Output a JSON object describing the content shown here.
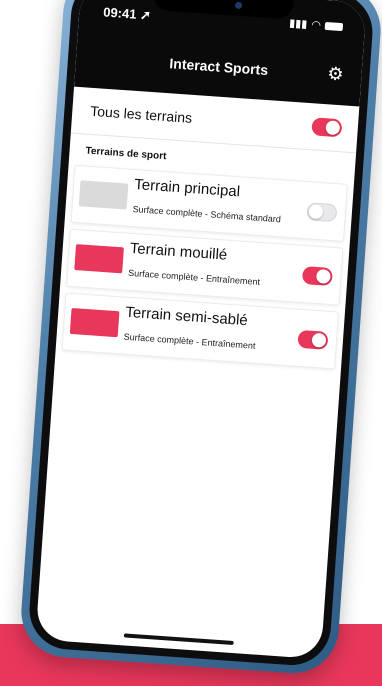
{
  "status_bar": {
    "time": "09:41"
  },
  "header": {
    "title": "Interact Sports"
  },
  "all_fields": {
    "label": "Tous les terrains",
    "enabled": true
  },
  "section": {
    "title": "Terrains de sport"
  },
  "fields": [
    {
      "name": "Terrain principal",
      "subtitle": "Surface complète - Schéma standard",
      "enabled": false,
      "thumb": "grey"
    },
    {
      "name": "Terrain mouillé",
      "subtitle": "Surface complète - Entraînement",
      "enabled": true,
      "thumb": "pink"
    },
    {
      "name": "Terrain semi-sablé",
      "subtitle": "Surface complète - Entraînement",
      "enabled": true,
      "thumb": "pink"
    }
  ],
  "colors": {
    "accent": "#e8375a",
    "header": "#0a0a0a",
    "phone_frame": "#4e7fa8"
  },
  "icons": {
    "settings": "gear-icon",
    "signal": "signal-icon",
    "wifi": "wifi-icon",
    "battery": "battery-icon",
    "location": "location-arrow-icon"
  }
}
